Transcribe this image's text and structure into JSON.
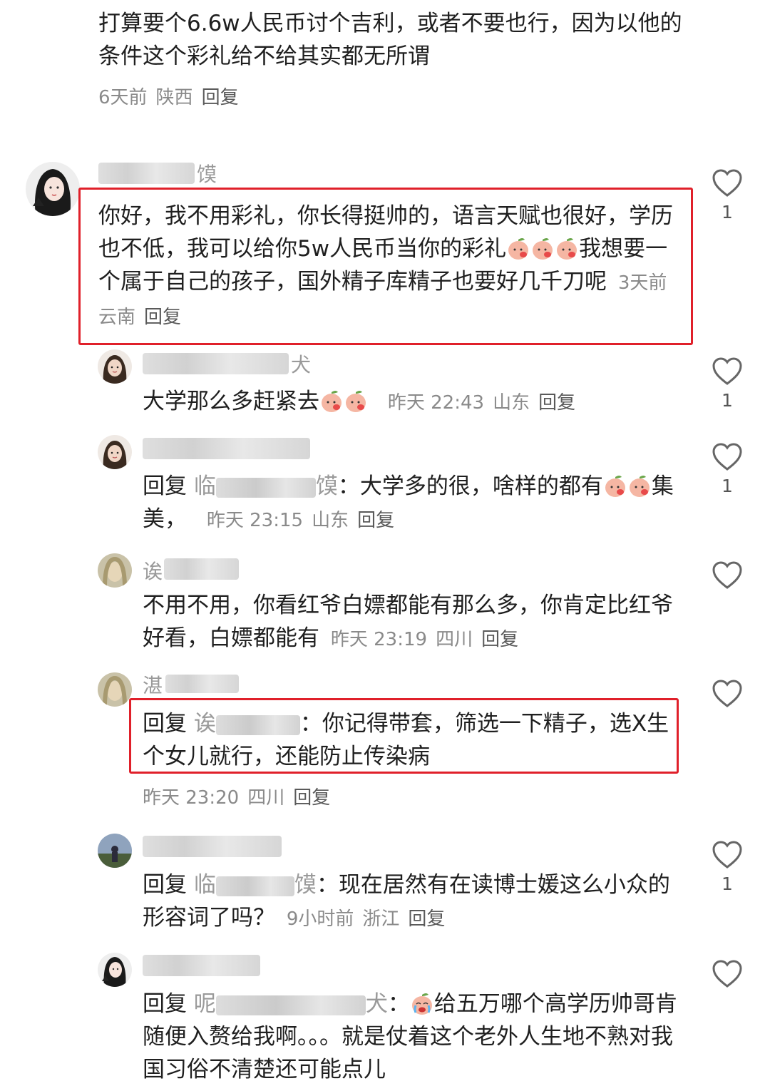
{
  "top_comment": {
    "text": "打算要个6.6w人民币讨个吉利，或者不要也行，因为以他的条件这个彩礼给不给其实都无所谓",
    "time": "6天前",
    "location": "陕西",
    "reply": "回复"
  },
  "comments": [
    {
      "name_tail": "馍",
      "text_a": "你好，我不用彩礼，你长得挺帅的，语言天赋也很好，学历也不低，我可以给你5w人民币当你的彩礼",
      "text_b": "我想要一个属于自己的孩子，国外精子库精子也要好几千刀呢",
      "time": "3天前",
      "location": "云南",
      "reply": "回复",
      "likes": "1",
      "emoji": [
        "peach-emoji",
        "peach-emoji",
        "peach-emoji"
      ]
    },
    {
      "name_tail": "犬",
      "text": "大学那么多赶紧去",
      "time": "昨天 22:43",
      "location": "山东",
      "reply": "回复",
      "likes": "1"
    },
    {
      "reply_prefix": "回复",
      "mention_head": "临",
      "mention_tail": "馍",
      "text_a": "：大学多的很，啥样的都有",
      "text_b": "集美，",
      "time": "昨天 23:15",
      "location": "山东",
      "reply": "回复",
      "likes": "1"
    },
    {
      "name_head": "诶",
      "text": "不用不用，你看红爷白嫖都能有那么多，你肯定比红爷好看，白嫖都能有",
      "time": "昨天 23:19",
      "location": "四川",
      "reply": "回复"
    },
    {
      "name_head": "湛",
      "reply_prefix": "回复",
      "mention_head": "诶",
      "text": "：你记得带套，筛选一下精子，选X生个女儿就行，还能防止传染病",
      "time": "昨天 23:20",
      "location": "四川",
      "reply": "回复"
    },
    {
      "reply_prefix": "回复",
      "mention_head": "临",
      "mention_tail": "馍",
      "text": "：现在居然有在读博士媛这么小众的形容词了吗？",
      "time": "9小时前",
      "location": "浙江",
      "reply": "回复",
      "likes": "1"
    },
    {
      "reply_prefix": "回复",
      "mention_head": "呢",
      "mention_tail": "犬",
      "text_a": "：",
      "text_b": "给五万哪个高学历帅哥肯随便入赘给我啊。。。就是仗着这个老外人生地不熟对我国习俗不清楚还可能点儿"
    }
  ],
  "colors": {
    "highlight_border": "#e0202a",
    "meta_text": "#8a8a8a",
    "body_text": "#1f1f1f"
  },
  "icons": [
    "heart-outline-icon",
    "peach-emoji",
    "crying-emoji"
  ]
}
